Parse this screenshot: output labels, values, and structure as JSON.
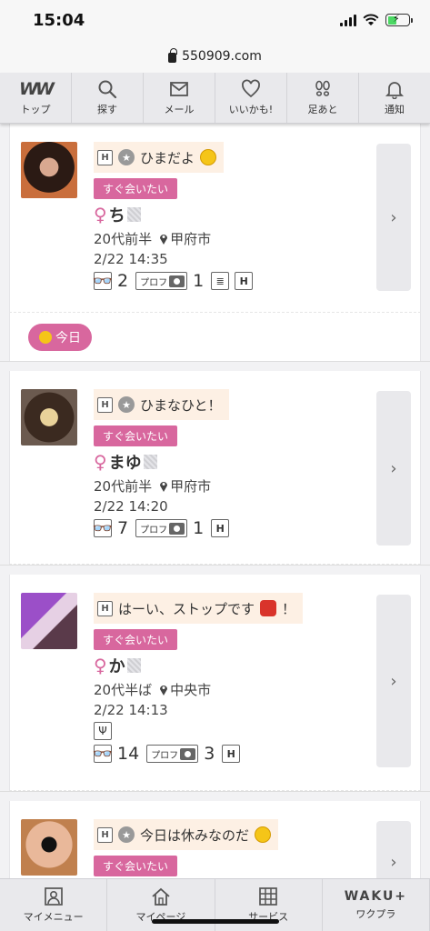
{
  "status": {
    "time": "15:04"
  },
  "browser": {
    "url": "550909.com"
  },
  "topnav": {
    "logo": "WW",
    "items": [
      {
        "label": "トップ",
        "icon": "ww-logo"
      },
      {
        "label": "探す",
        "icon": "search-icon"
      },
      {
        "label": "メール",
        "icon": "mail-icon"
      },
      {
        "label": "いいかも!",
        "icon": "heart-icon"
      },
      {
        "label": "足あと",
        "icon": "footprint-icon"
      },
      {
        "label": "通知",
        "icon": "bell-icon"
      }
    ]
  },
  "feed": {
    "separator": {
      "label": "今日"
    },
    "posts": [
      {
        "message": "ひまだよ",
        "tag": "すぐ会いたい",
        "name": "ち",
        "age": "20代前半",
        "location": "甲府市",
        "time": "2/22 14:35",
        "views": "2",
        "photos": "1",
        "h_badge": "H",
        "emoji": "smile"
      },
      {
        "message": "ひまなひと！",
        "tag": "すぐ会いたい",
        "name": "まゆ",
        "age": "20代前半",
        "location": "甲府市",
        "time": "2/22 14:20",
        "views": "7",
        "photos": "1",
        "h_badge": "H"
      },
      {
        "message": "はーい、ストップです",
        "message_end": "！",
        "tag": "すぐ会いたい",
        "name": "か",
        "age": "20代半ば",
        "location": "中央市",
        "time": "2/22 14:13",
        "views": "14",
        "photos": "3",
        "h_badge": "H",
        "emoji": "stop"
      },
      {
        "message": "今日は休みなのだ",
        "tag": "すぐ会いたい",
        "name": "",
        "h_badge": "H",
        "emoji": "tongue"
      }
    ],
    "prof_label": "プロフ",
    "arrow": "›"
  },
  "bottomnav": {
    "items": [
      {
        "label": "マイメニュー",
        "icon": "profile-icon"
      },
      {
        "label": "マイページ",
        "icon": "home-icon"
      },
      {
        "label": "サービス",
        "icon": "grid-icon"
      },
      {
        "label": "ワクプラ",
        "logo": "WAKU+"
      }
    ]
  },
  "colors": {
    "accent": "#d8679e",
    "bubble": "#fdf0e4",
    "nav": "#e9e9ec"
  }
}
